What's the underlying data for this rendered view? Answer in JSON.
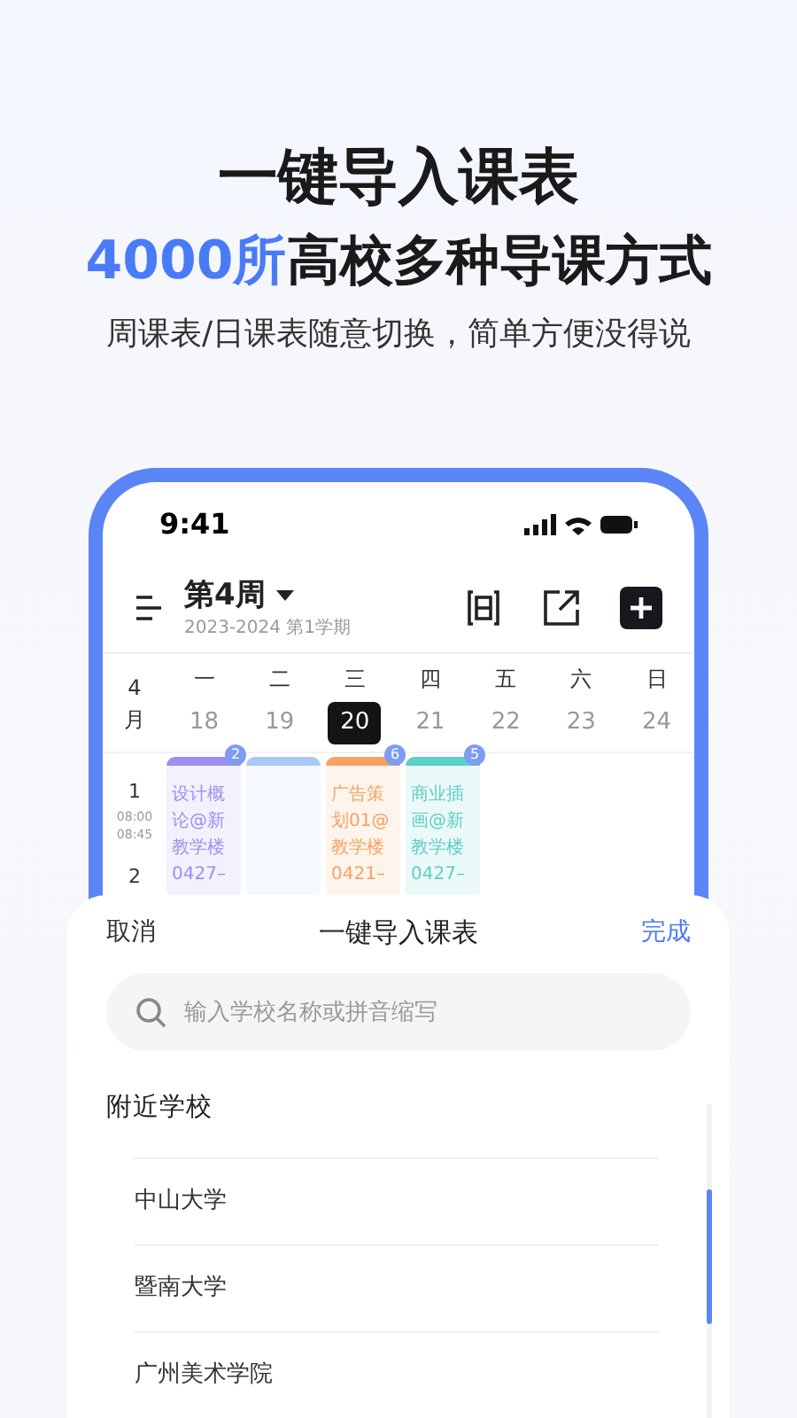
{
  "headline": "一键导入课表",
  "subheadline": {
    "highlight": "4000所",
    "rest": "高校多种导课方式"
  },
  "tagline": "周课表/日课表随意切换，简单方便没得说",
  "phone": {
    "time": "9:41",
    "week": "第4周",
    "term": "2023-2024 第1学期",
    "month": "4\n月",
    "days": [
      {
        "weekday": "一",
        "date": "18",
        "selected": false
      },
      {
        "weekday": "二",
        "date": "19",
        "selected": false
      },
      {
        "weekday": "三",
        "date": "20",
        "selected": true
      },
      {
        "weekday": "四",
        "date": "21",
        "selected": false
      },
      {
        "weekday": "五",
        "date": "22",
        "selected": false
      },
      {
        "weekday": "六",
        "date": "23",
        "selected": false
      },
      {
        "weekday": "日",
        "date": "24",
        "selected": false
      }
    ],
    "periods": [
      {
        "number": "1",
        "start": "08:00",
        "end": "08:45"
      },
      {
        "number": "2"
      }
    ],
    "courses": [
      {
        "text": "设计概论@新教学楼0427–",
        "badge": "2",
        "color": "#9d8ef2"
      },
      {
        "color": "#a9c8f5"
      },
      {
        "text": "广告策划01@教学楼0421–",
        "badge": "6",
        "color": "#f7a165"
      },
      {
        "text": "商业插画@新教学楼0427–",
        "badge": "5",
        "color": "#5ccfc6"
      }
    ]
  },
  "sheet": {
    "cancel": "取消",
    "title": "一键导入课表",
    "done": "完成",
    "search": {
      "placeholder": "输入学校名称或拼音缩写"
    },
    "section": "附近学校",
    "schools": [
      "中山大学",
      "暨南大学",
      "广州美术学院"
    ]
  }
}
